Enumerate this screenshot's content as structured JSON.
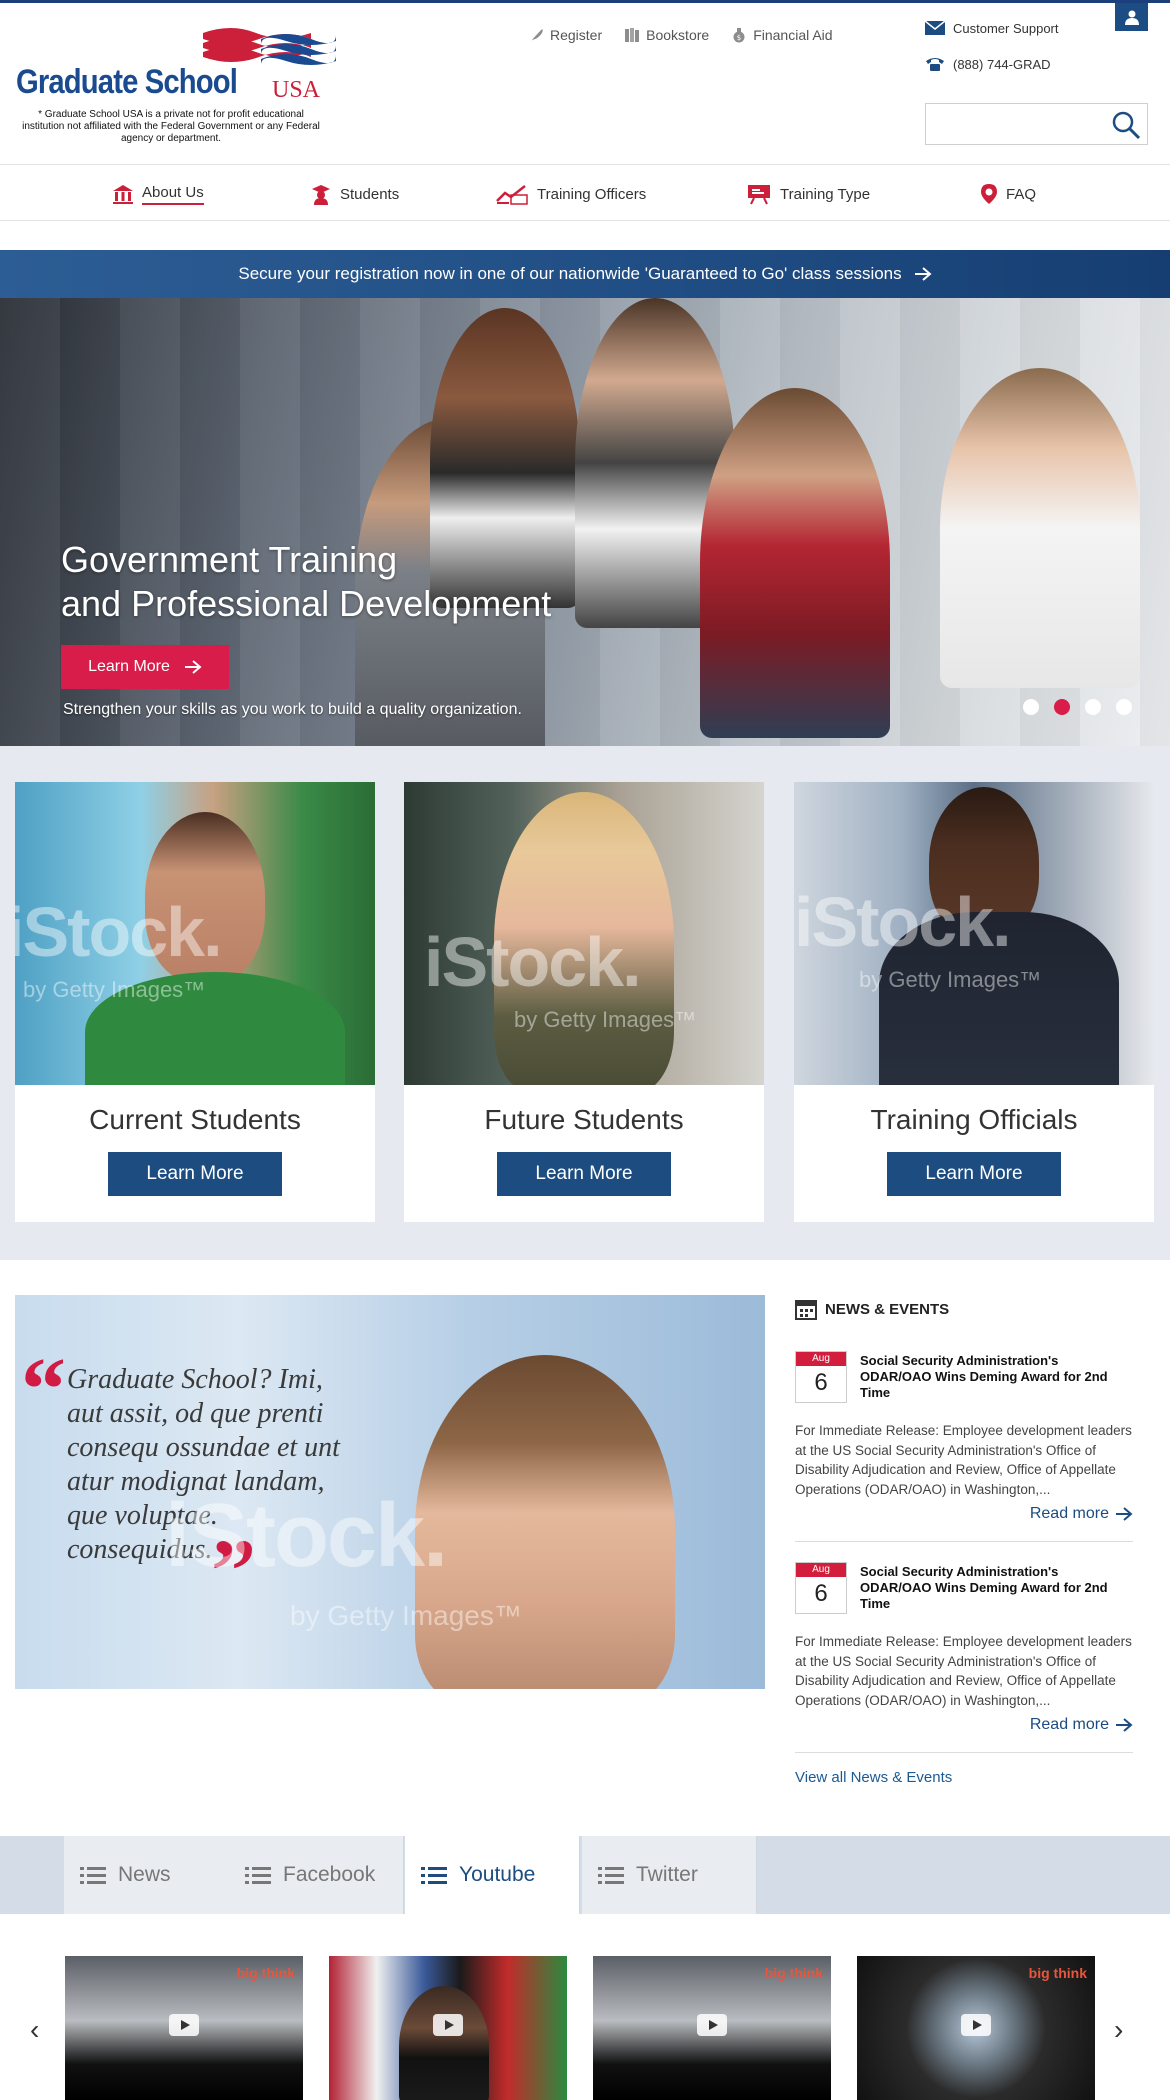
{
  "brand": {
    "name_main": "Graduate School",
    "name_suffix": "USA",
    "disclaimer": "* Graduate School USA is a private not for profit educational institution not affiliated with the Federal Government or any Federal agency or department.",
    "colors": {
      "primary": "#1c4c80",
      "accent": "#d81d4a",
      "logo_blue": "#1a4a8f"
    }
  },
  "toplinks": [
    {
      "label": "Register",
      "icon": "feather-icon"
    },
    {
      "label": "Bookstore",
      "icon": "books-icon"
    },
    {
      "label": "Financial Aid",
      "icon": "money-bag-icon"
    }
  ],
  "support": {
    "customer_support": "Customer Support",
    "phone": "(888) 744-GRAD"
  },
  "search": {
    "placeholder": ""
  },
  "nav": [
    {
      "label": "About Us",
      "icon": "building-icon",
      "active": true
    },
    {
      "label": "Students",
      "icon": "graduate-icon"
    },
    {
      "label": "Training Officers",
      "icon": "chart-icon"
    },
    {
      "label": "Training Type",
      "icon": "presentation-icon"
    },
    {
      "label": "FAQ",
      "icon": "location-pin-icon"
    }
  ],
  "banner": {
    "text": "Secure your registration now in one of our nationwide 'Guaranteed to Go' class sessions"
  },
  "hero": {
    "title_line1": "Government Training",
    "title_line2": "and Professional Development",
    "button": "Learn More",
    "subtitle": "Strengthen your skills as you work to build a quality organization.",
    "slides": 4,
    "active_slide": 2
  },
  "cards": [
    {
      "title": "Current Students",
      "button": "Learn More"
    },
    {
      "title": "Future Students",
      "button": "Learn More"
    },
    {
      "title": "Training Officials",
      "button": "Learn More"
    }
  ],
  "watermark": {
    "main": "iStock.",
    "sub": "by Getty Images™"
  },
  "quote": {
    "text": "Graduate School? Imi, aut assit, od que prenti consequ ossundae et unt atur modignat landam, que voluptae. consequidus."
  },
  "news": {
    "heading": "NEWS & EVENTS",
    "items": [
      {
        "month": "Aug",
        "day": "6",
        "title": "Social Security Administration's ODAR/OAO Wins Deming Award for 2nd Time",
        "body": "For Immediate Release: Employee development leaders at the US Social Security Administration's Office of Disability Adjudication and Review, Office of Appellate Operations (ODAR/OAO) in Washington,...",
        "link": "Read more"
      },
      {
        "month": "Aug",
        "day": "6",
        "title": "Social Security Administration's ODAR/OAO Wins Deming Award for 2nd Time",
        "body": "For Immediate Release: Employee development leaders at the US Social Security Administration's Office of Disability Adjudication and Review, Office of Appellate Operations (ODAR/OAO) in Washington,...",
        "link": "Read more"
      }
    ],
    "view_all": "View all News & Events"
  },
  "tabs": [
    {
      "label": "News",
      "active": false
    },
    {
      "label": "Facebook",
      "active": false
    },
    {
      "label": "Youtube",
      "active": true
    },
    {
      "label": "Twitter",
      "active": false
    }
  ],
  "videos": [
    {
      "tag": "big think"
    },
    {
      "tag": ""
    },
    {
      "tag": "big think"
    },
    {
      "tag": "big think"
    }
  ]
}
